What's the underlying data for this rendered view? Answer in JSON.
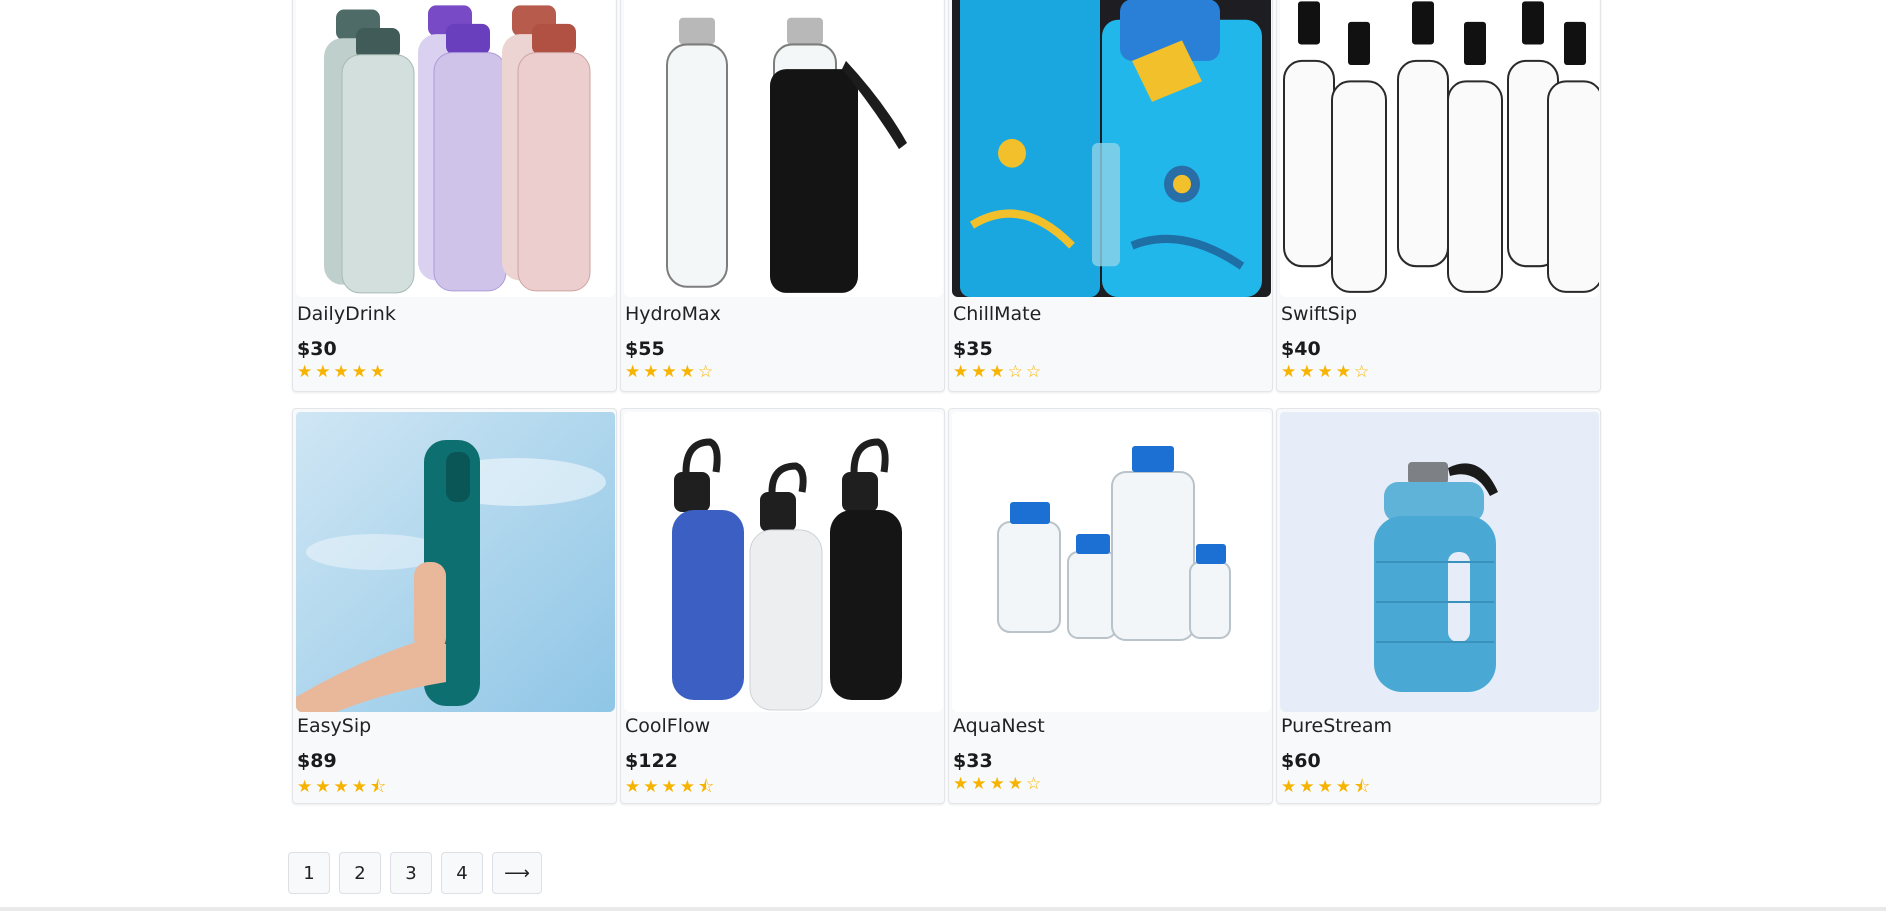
{
  "products": [
    {
      "name": "DailyDrink",
      "price": "$30",
      "rating": 5,
      "image": "bottle-set-colored"
    },
    {
      "name": "HydroMax",
      "price": "$55",
      "rating": 4,
      "image": "glass-bottle-sleeve"
    },
    {
      "name": "ChillMate",
      "price": "$35",
      "rating": 3,
      "image": "kids-bottle-blue"
    },
    {
      "name": "SwiftSip",
      "price": "$40",
      "rating": 4,
      "image": "clear-bottles"
    },
    {
      "name": "EasySip",
      "price": "$89",
      "rating": 4.5,
      "image": "teal-bottle-sky"
    },
    {
      "name": "CoolFlow",
      "price": "$122",
      "rating": 4.5,
      "image": "insulated-bottles"
    },
    {
      "name": "AquaNest",
      "price": "$33",
      "rating": 4,
      "image": "lab-bottles"
    },
    {
      "name": "PureStream",
      "price": "$60",
      "rating": 4.5,
      "image": "gallon-jug"
    }
  ],
  "pagination": {
    "pages": [
      "1",
      "2",
      "3",
      "4"
    ],
    "next": "⟶"
  },
  "colors": {
    "star": "#f6b300",
    "card_bg": "#f8f9fa",
    "border": "#e3e5e8"
  }
}
